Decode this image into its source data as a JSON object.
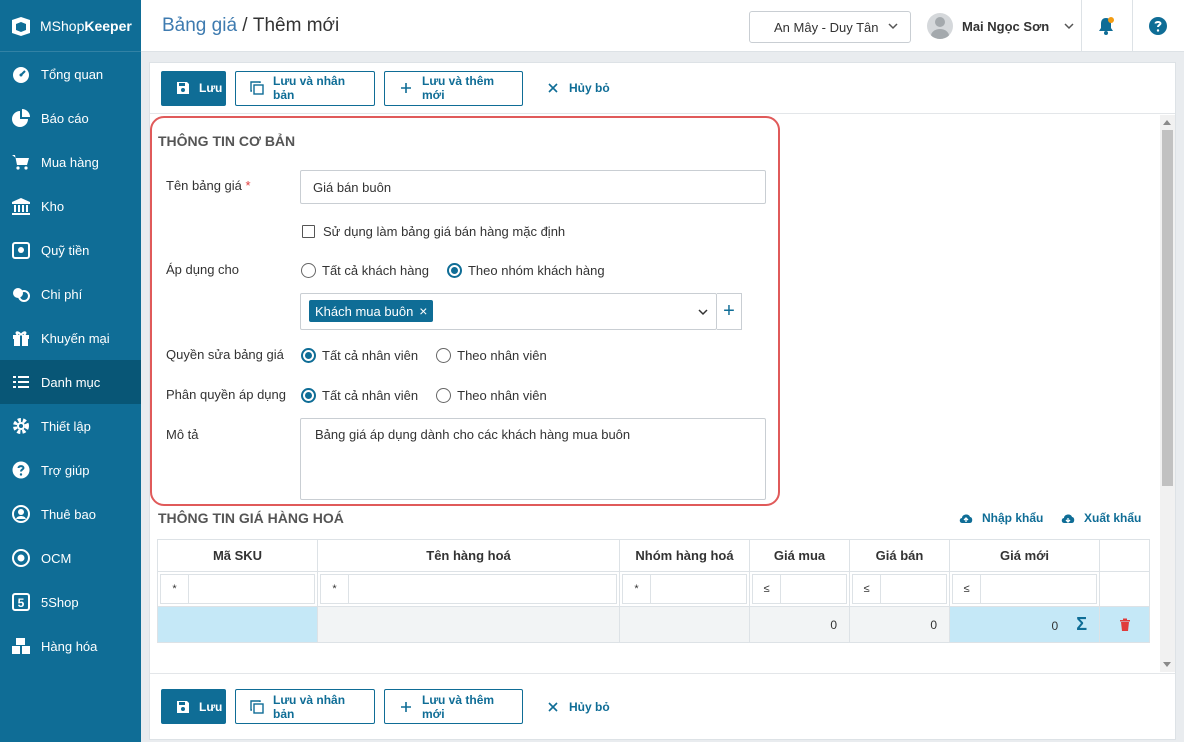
{
  "app": {
    "logo_prefix": "MShop",
    "logo_suffix": "Keeper"
  },
  "sidebar": {
    "items": [
      {
        "label": "Tổng quan",
        "icon": "dashboard-icon"
      },
      {
        "label": "Báo cáo",
        "icon": "pie-chart-icon"
      },
      {
        "label": "Mua hàng",
        "icon": "cart-icon"
      },
      {
        "label": "Kho",
        "icon": "warehouse-icon"
      },
      {
        "label": "Quỹ tiền",
        "icon": "safe-icon"
      },
      {
        "label": "Chi phí",
        "icon": "money-icon"
      },
      {
        "label": "Khuyến mại",
        "icon": "gift-icon"
      },
      {
        "label": "Danh mục",
        "icon": "list-icon"
      },
      {
        "label": "Thiết lập",
        "icon": "gear-icon"
      },
      {
        "label": "Trợ giúp",
        "icon": "help-icon"
      },
      {
        "label": "Thuê bao",
        "icon": "user-icon"
      },
      {
        "label": "OCM",
        "icon": "ocm-icon"
      },
      {
        "label": "5Shop",
        "icon": "5shop-icon"
      },
      {
        "label": "Hàng hóa",
        "icon": "boxes-icon"
      }
    ],
    "active_index": 7
  },
  "header": {
    "breadcrumb_parent": "Bảng giá",
    "breadcrumb_sep": " / ",
    "breadcrumb_current": "Thêm mới",
    "store": "An Mây - Duy Tân",
    "user_name": "Mai Ngọc Sơn"
  },
  "toolbar": {
    "save": "Lưu",
    "save_duplicate": "Lưu và nhân bản",
    "save_add_new": "Lưu và thêm mới",
    "cancel": "Hủy bỏ"
  },
  "basic_info": {
    "title": "THÔNG TIN CƠ BẢN",
    "name_label": "Tên bảng giá",
    "name_required": "*",
    "name_value": "Giá bán buôn",
    "default_checkbox": "Sử dụng làm bảng giá bán hàng mặc định",
    "apply_label": "Áp dụng cho",
    "apply_all": "Tất cả khách hàng",
    "apply_group": "Theo nhóm khách hàng",
    "group_tag": "Khách mua buôn",
    "edit_perm_label": "Quyền sửa bảng giá",
    "apply_perm_label": "Phân quyền áp dụng",
    "all_staff": "Tất cả nhân viên",
    "by_staff": "Theo nhân viên",
    "desc_label": "Mô tả",
    "desc_value": "Bảng giá áp dụng dành cho các khách hàng mua buôn"
  },
  "goods_price": {
    "title": "THÔNG TIN GIÁ HÀNG HOÁ",
    "import": "Nhập khẩu",
    "export": "Xuất khẩu",
    "columns": [
      "Mã SKU",
      "Tên hàng hoá",
      "Nhóm hàng hoá",
      "Giá mua",
      "Giá bán",
      "Giá mới"
    ],
    "filter_ops": [
      "*",
      "*",
      "*",
      "≤",
      "≤",
      "≤"
    ],
    "row": {
      "purchase_price": "0",
      "sale_price": "0",
      "new_price": "0"
    }
  }
}
